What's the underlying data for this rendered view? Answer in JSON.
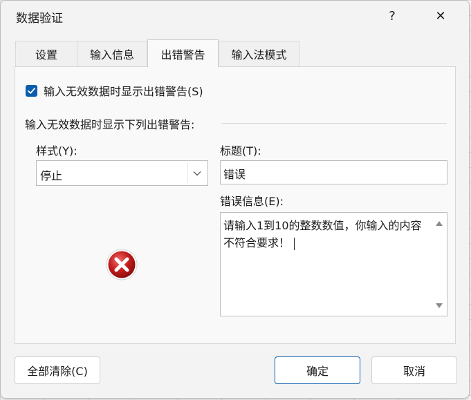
{
  "window": {
    "title": "数据验证",
    "help_glyph": "?",
    "close_glyph": "✕"
  },
  "tabs": [
    {
      "label": "设置",
      "active": false
    },
    {
      "label": "输入信息",
      "active": false
    },
    {
      "label": "出错警告",
      "active": true
    },
    {
      "label": "输入法模式",
      "active": false
    }
  ],
  "error_alert": {
    "show_checkbox_label": "输入无效数据时显示出错警告(S)",
    "show_checked": true,
    "group_label": "输入无效数据时显示下列出错警告:",
    "style_label": "样式(Y):",
    "style_value": "停止",
    "title_label": "标题(T):",
    "title_value": "错误",
    "message_label": "错误信息(E):",
    "message_value": "请输入1到10的整数数值，你输入的内容不符合要求！",
    "style_icon": "stop-error-icon"
  },
  "footer": {
    "clear_all_label": "全部清除(C)",
    "ok_label": "确定",
    "cancel_label": "取消"
  },
  "colors": {
    "accent": "#0b5cad",
    "dialog_bg": "#f3f3f3",
    "error_red": "#c21b1b"
  }
}
